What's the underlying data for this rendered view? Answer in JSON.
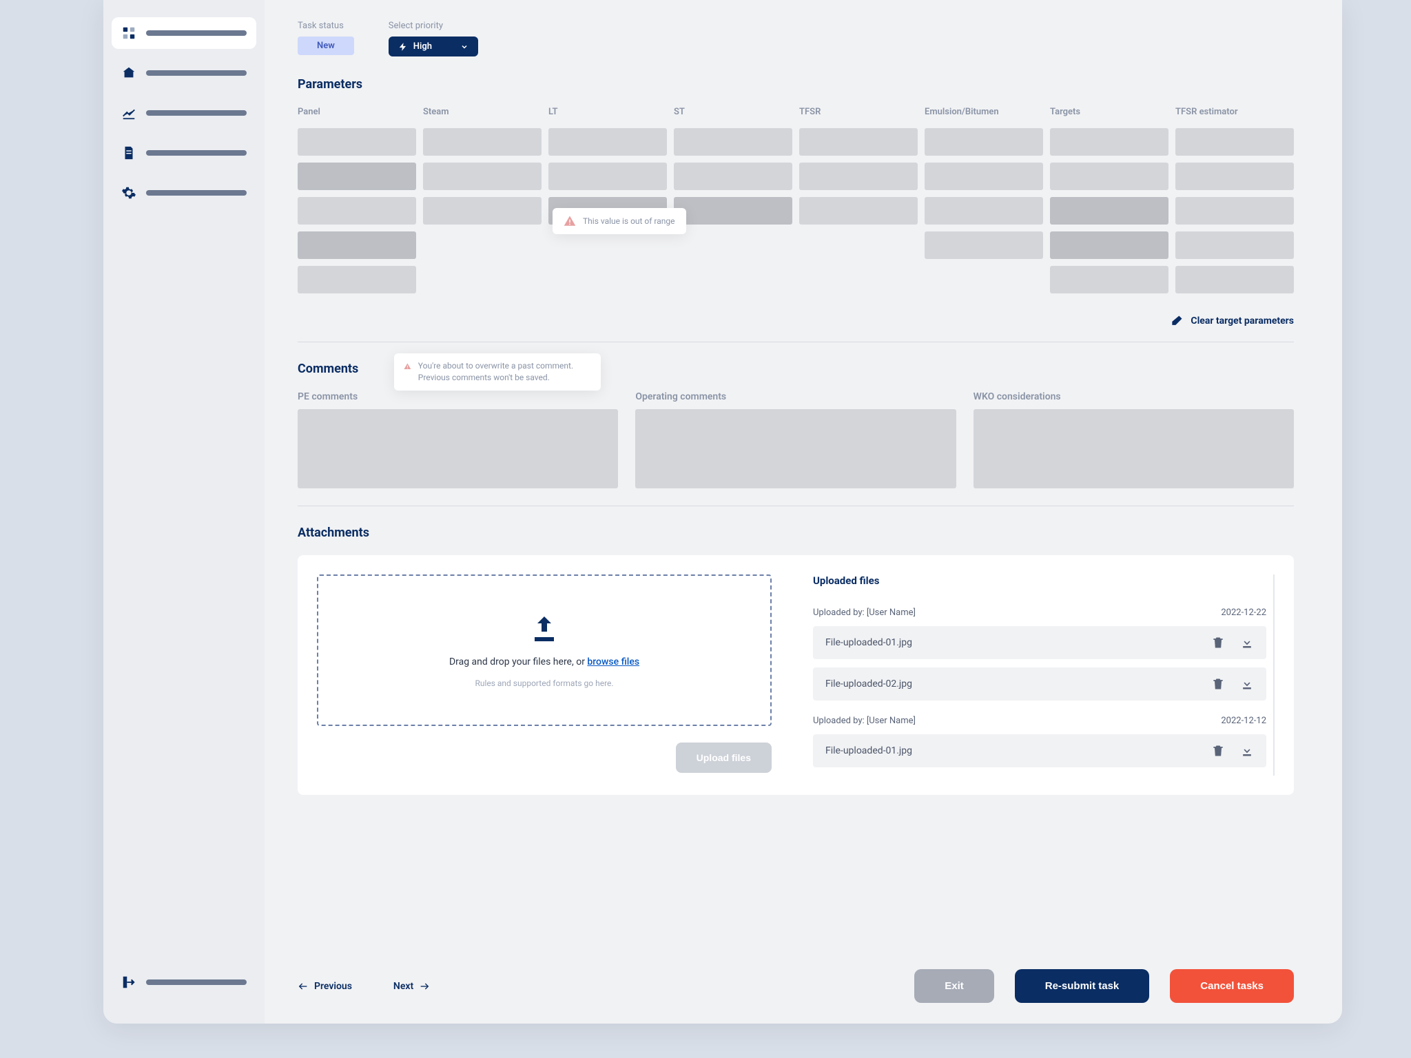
{
  "task_status": {
    "label": "Task status",
    "value": "New"
  },
  "priority": {
    "label": "Select priority",
    "value": "High"
  },
  "parameters": {
    "title": "Parameters",
    "columns": [
      "Panel",
      "Steam",
      "LT",
      "ST",
      "TFSR",
      "Emulsion/Bitumen",
      "Targets",
      "TFSR estimator"
    ],
    "tooltip_range": "This value is out of range",
    "clear_label": "Clear target parameters"
  },
  "comments": {
    "title": "Comments",
    "tooltip": "You're about to overwrite a past comment. Previous comments won't be saved.",
    "labels": {
      "pe": "PE comments",
      "operating": "Operating comments",
      "wko": "WKO considerations"
    }
  },
  "attachments": {
    "title": "Attachments",
    "dropzone_prefix": "Drag and drop your files here, or ",
    "browse": "browse files",
    "rules": "Rules and supported formats go here.",
    "upload_btn": "Upload files",
    "uploaded_title": "Uploaded files",
    "groups": [
      {
        "by": "Uploaded by: [User Name]",
        "date": "2022-12-22",
        "files": [
          "File-uploaded-01.jpg",
          "File-uploaded-02.jpg"
        ]
      },
      {
        "by": "Uploaded by: [User Name]",
        "date": "2022-12-12",
        "files": [
          "File-uploaded-01.jpg"
        ]
      }
    ]
  },
  "footer": {
    "prev": "Previous",
    "next": "Next",
    "exit": "Exit",
    "resubmit": "Re-submit task",
    "cancel": "Cancel tasks"
  }
}
